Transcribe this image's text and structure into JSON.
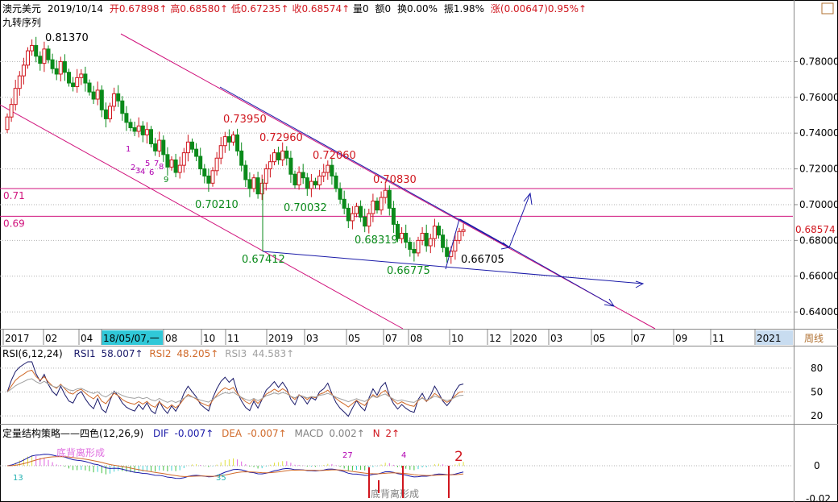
{
  "header": {
    "symbol": "澳元美元",
    "date": "2019/10/14",
    "items": [
      {
        "label": "开",
        "value": "0.67898↑",
        "color": "#d0161e"
      },
      {
        "label": "高",
        "value": "0.68580↑",
        "color": "#d0161e"
      },
      {
        "label": "低",
        "value": "0.67235↑",
        "color": "#d0161e"
      },
      {
        "label": "收",
        "value": "0.68574↑",
        "color": "#d0161e"
      },
      {
        "label": "量",
        "value": "0",
        "color": "#000000"
      },
      {
        "label": "额",
        "value": "0",
        "color": "#000000"
      },
      {
        "label": "换",
        "value": "0.00%",
        "color": "#000000"
      },
      {
        "label": "振",
        "value": "1.98%",
        "color": "#000000"
      },
      {
        "label": "涨",
        "value": "(0.00647)0.95%↑",
        "color": "#d0161e"
      }
    ],
    "indicator_name": "九转序列"
  },
  "colors": {
    "up": "#d0161e",
    "down": "#0a8a1a",
    "channel": "#d0127c",
    "trend": "#1a1aa8",
    "hline": "#d0127c",
    "grid": "#b0b0b0",
    "rsi1": "#1a1a6a",
    "rsi2": "#d06a2a",
    "rsi3": "#a0a0a0",
    "dif": "#1a1aa8",
    "dea": "#d06a2a"
  },
  "chart_data": [
    {
      "type": "candlestick",
      "title": "澳元美元 周线",
      "period_label": "周线",
      "y_ticks": [
        0.78,
        0.76,
        0.74,
        0.72,
        0.7,
        0.68,
        0.66,
        0.64
      ],
      "y_tick_labels": [
        "0.78000",
        "0.76000",
        "0.74000",
        "0.72000",
        "0.70000",
        "0.68000",
        "0.66000",
        "0.64000"
      ],
      "ylim": [
        0.6315,
        0.7955
      ],
      "last_price_label": "0.68574",
      "x_tick_labels": [
        "2017",
        "02",
        "04",
        "18/05/07,一",
        "08",
        "10",
        "11",
        "2019",
        "03",
        "05",
        "07",
        "08",
        "10",
        "12",
        "2020",
        "03",
        "05",
        "07",
        "09",
        "11",
        "2021"
      ],
      "horizontal_lines": [
        {
          "value": 0.709,
          "label": "0.71"
        },
        {
          "value": 0.6935,
          "label": "0.69"
        }
      ],
      "price_annotations": [
        {
          "text": "0.81370",
          "color": "#000000"
        },
        {
          "text": "0.73950",
          "color": "#d0161e"
        },
        {
          "text": "0.72960",
          "color": "#d0161e"
        },
        {
          "text": "0.72060",
          "color": "#d0161e"
        },
        {
          "text": "0.70830",
          "color": "#d0161e"
        },
        {
          "text": "0.70210",
          "color": "#0a8a1a"
        },
        {
          "text": "0.70032",
          "color": "#0a8a1a"
        },
        {
          "text": "0.68319",
          "color": "#0a8a1a"
        },
        {
          "text": "0.67412",
          "color": "#0a8a1a"
        },
        {
          "text": "0.66775",
          "color": "#0a8a1a"
        },
        {
          "text": "0.66705",
          "color": "#000000"
        }
      ],
      "nine_turn_labels": [
        {
          "text": "1",
          "color": "#b000b0"
        },
        {
          "text": "2",
          "color": "#b000b0"
        },
        {
          "text": "3",
          "color": "#b000b0"
        },
        {
          "text": "4",
          "color": "#b000b0"
        },
        {
          "text": "5",
          "color": "#b000b0"
        },
        {
          "text": "6",
          "color": "#b000b0"
        },
        {
          "text": "7",
          "color": "#b000b0"
        },
        {
          "text": "8",
          "color": "#b000b0"
        },
        {
          "text": "9",
          "color": "#0a8a1a"
        }
      ],
      "closes": [
        0.749,
        0.756,
        0.765,
        0.772,
        0.778,
        0.786,
        0.789,
        0.783,
        0.779,
        0.787,
        0.781,
        0.776,
        0.773,
        0.78,
        0.774,
        0.768,
        0.766,
        0.771,
        0.773,
        0.768,
        0.763,
        0.759,
        0.764,
        0.753,
        0.748,
        0.755,
        0.762,
        0.758,
        0.751,
        0.746,
        0.743,
        0.741,
        0.744,
        0.739,
        0.742,
        0.734,
        0.73,
        0.736,
        0.728,
        0.721,
        0.725,
        0.718,
        0.722,
        0.729,
        0.735,
        0.731,
        0.727,
        0.72,
        0.716,
        0.712,
        0.719,
        0.726,
        0.733,
        0.738,
        0.735,
        0.739,
        0.73,
        0.722,
        0.714,
        0.709,
        0.715,
        0.706,
        0.712,
        0.72,
        0.724,
        0.729,
        0.725,
        0.73,
        0.726,
        0.717,
        0.711,
        0.718,
        0.715,
        0.709,
        0.713,
        0.711,
        0.716,
        0.718,
        0.722,
        0.716,
        0.709,
        0.703,
        0.698,
        0.691,
        0.695,
        0.699,
        0.693,
        0.688,
        0.695,
        0.702,
        0.697,
        0.704,
        0.708,
        0.698,
        0.689,
        0.681,
        0.684,
        0.679,
        0.675,
        0.673,
        0.68,
        0.684,
        0.677,
        0.681,
        0.688,
        0.683,
        0.676,
        0.671,
        0.674,
        0.68,
        0.685,
        0.686
      ]
    },
    {
      "type": "line",
      "title": "RSI(6,12,24)",
      "series": [
        {
          "name": "RSI1",
          "value_label": "58.007↑",
          "color": "#1a1a6a"
        },
        {
          "name": "RSI2",
          "value_label": "48.205↑",
          "color": "#d06a2a"
        },
        {
          "name": "RSI3",
          "value_label": "44.583↑",
          "color": "#a0a0a0"
        }
      ],
      "y_ticks": [
        80,
        50,
        20
      ],
      "ylim": [
        12,
        88
      ]
    },
    {
      "type": "bar",
      "title": "定量结构策略——四色(12,26,9)",
      "series": [
        {
          "name": "DIF",
          "value_label": "-0.007↑",
          "color": "#1a1aa8"
        },
        {
          "name": "DEA",
          "value_label": "-0.007↑",
          "color": "#d06a2a"
        },
        {
          "name": "MACD",
          "value_label": "0.002↑",
          "color": "#808080"
        },
        {
          "name": "N",
          "value_label": "2↑",
          "color": "#d0161e"
        }
      ],
      "y_ticks": [
        0
      ],
      "y_tick_labels": [
        "0",
        "-0.02"
      ],
      "labels": [
        {
          "text": "13",
          "color": "#20b0b0"
        },
        {
          "text": "35",
          "color": "#20b0b0"
        },
        {
          "text": "27",
          "color": "#b000b0"
        },
        {
          "text": "4",
          "color": "#b000b0"
        },
        {
          "text": "2",
          "color": "#d0161e"
        },
        {
          "text": "底背离形成",
          "color": "#e070e0"
        },
        {
          "text": "底背离形成",
          "color": "#808080"
        }
      ]
    }
  ]
}
